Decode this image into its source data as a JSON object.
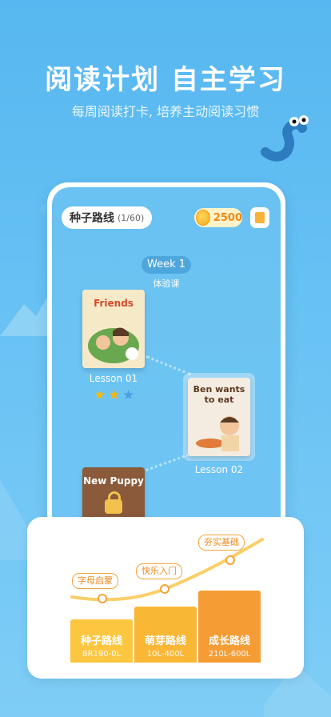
{
  "headline": "阅读计划  自主学习",
  "subheadline": "每周阅读打卡, 培养主动阅读习惯",
  "app": {
    "route_name": "种子路线",
    "route_progress": "(1/60)",
    "coins": "2500",
    "week_label": "Week 1",
    "week_subtitle": "体验课"
  },
  "lessons": [
    {
      "label": "Lesson 01",
      "book_title": "Friends",
      "stars": 2,
      "max_stars": 3
    },
    {
      "label": "Lesson 02",
      "book_title": "Ben wants to eat"
    },
    {
      "label": "",
      "book_title": "New Puppy"
    }
  ],
  "roadmap": {
    "milestones": [
      "字母启蒙",
      "快乐入门",
      "夯实基础"
    ],
    "levels": [
      {
        "name": "种子路线",
        "range": "BR190-0L"
      },
      {
        "name": "萌芽路线",
        "range": "10L-400L"
      },
      {
        "name": "成长路线",
        "range": "210L-600L"
      }
    ]
  },
  "colors": {
    "sky": "#5ab8f1",
    "accent_orange": "#f5a93a",
    "star_gold": "#f6b70f",
    "star_empty": "#4a9fe0"
  }
}
